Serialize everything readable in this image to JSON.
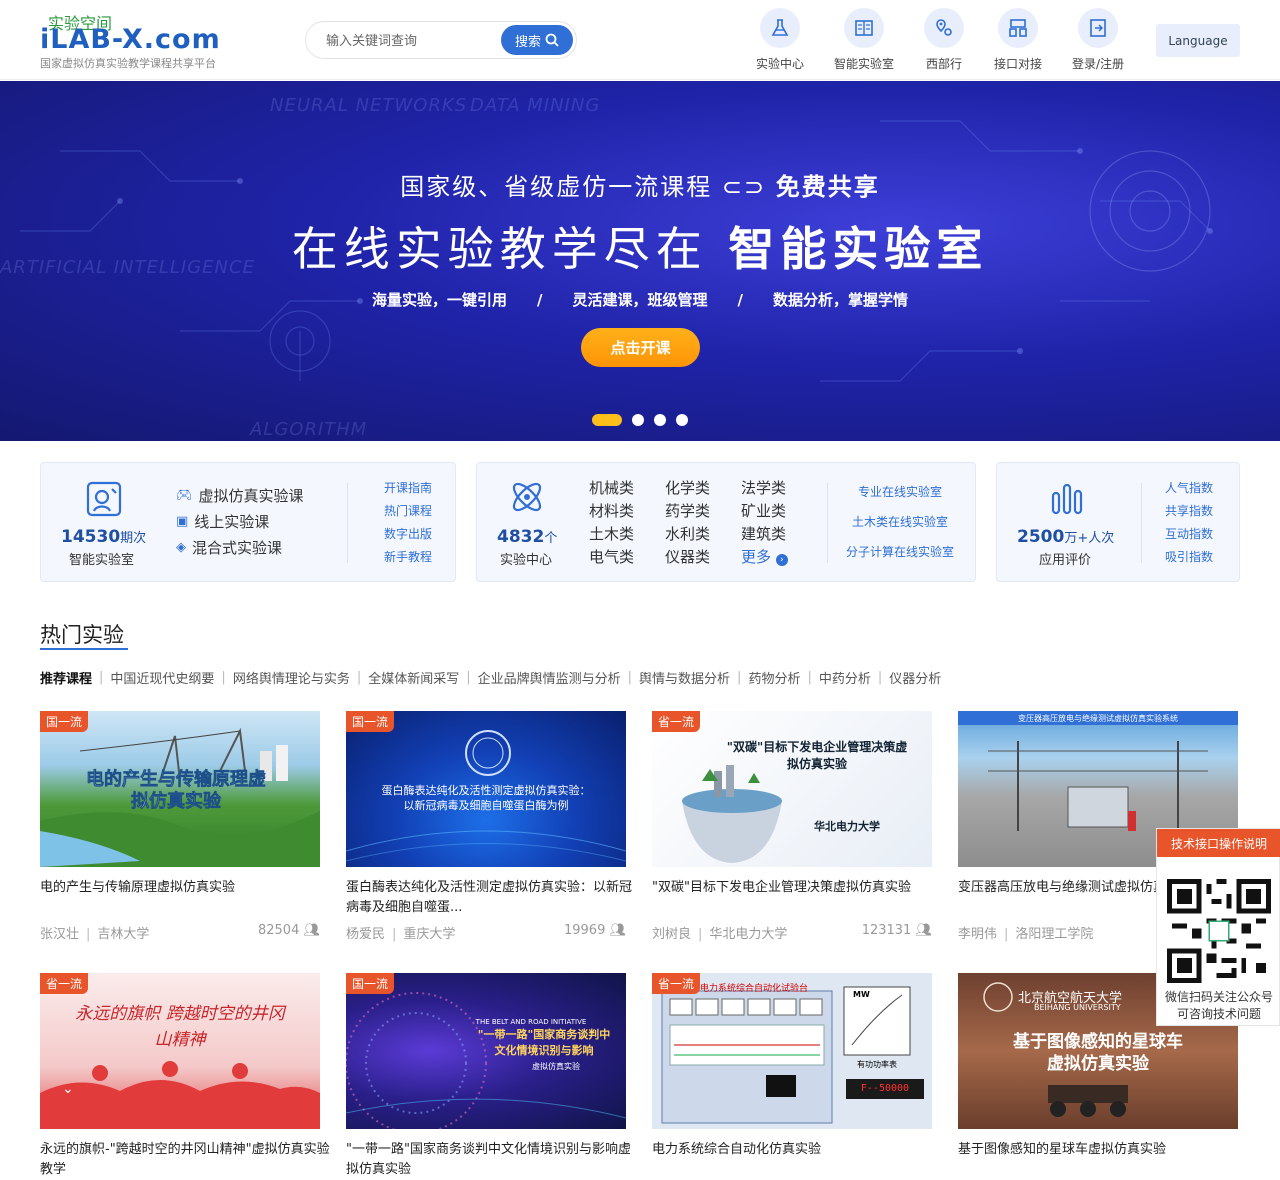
{
  "header": {
    "logo_cn": "实验空间",
    "logo_en": "iLAB-X.com",
    "logo_sub": "国家虚拟仿真实验教学课程共享平台",
    "search_placeholder": "输入关键词查询",
    "search_btn": "搜索",
    "nav": [
      "实验中心",
      "智能实验室",
      "西部行",
      "接口对接",
      "登录/注册"
    ],
    "language": "Language"
  },
  "banner": {
    "line1_a": "国家级、省级虚仿一流课程",
    "line1_b": "免费共享",
    "line2_a": "在线实验教学尽在",
    "line2_b": "智能实验室",
    "line3": "海量实验，一键引用　　/　　灵活建课，班级管理　　/　　数据分析，掌握学情",
    "btn": "点击开课",
    "slide_count": 4,
    "active_slide": 1
  },
  "stats": {
    "lab": {
      "num": "14530",
      "unit": "期次",
      "label": "智能实验室",
      "types": [
        "虚拟仿真实验课",
        "线上实验课",
        "混合式实验课"
      ],
      "links": [
        "开课指南",
        "热门课程",
        "数字出版",
        "新手教程"
      ]
    },
    "center": {
      "num": "4832",
      "unit": "个",
      "label": "实验中心",
      "cats": [
        "机械类",
        "化学类",
        "法学类",
        "材料类",
        "药学类",
        "矿业类",
        "土木类",
        "水利类",
        "建筑类",
        "电气类",
        "仪器类"
      ],
      "more": "更多",
      "links": [
        "专业在线实验室",
        "土木类在线实验室",
        "分子计算在线实验室"
      ]
    },
    "eval": {
      "num": "2500",
      "unit": "万+人次",
      "label": "应用评价",
      "links": [
        "人气指数",
        "共享指数",
        "互动指数",
        "吸引指数"
      ]
    }
  },
  "hot": {
    "title": "热门实验",
    "tabs": [
      "推荐课程",
      "中国近现代史纲要",
      "网络舆情理论与实务",
      "全媒体新闻采写",
      "企业品牌舆情监测与分析",
      "舆情与数据分析",
      "药物分析",
      "中药分析",
      "仪器分析"
    ],
    "cards": [
      {
        "badge": "国一流",
        "title": "电的产生与传输原理虚拟仿真实验",
        "teacher": "张汉壮",
        "school": "吉林大学",
        "views": "82504",
        "thumb_text": "电的产生与传输原理虚拟仿真实验"
      },
      {
        "badge": "国一流",
        "title": "蛋白酶表达纯化及活性测定虚拟仿真实验：以新冠病毒及细胞自噬蛋...",
        "teacher": "杨爱民",
        "school": "重庆大学",
        "views": "19969",
        "thumb_text": "蛋白酶表达纯化及活性测定虚拟仿真实验：以新冠病毒及细胞自噬蛋白酶为例"
      },
      {
        "badge": "省一流",
        "title": "\"双碳\"目标下发电企业管理决策虚拟仿真实验",
        "teacher": "刘树良",
        "school": "华北电力大学",
        "views": "123131",
        "thumb_text": "\"双碳\"目标下发电企业管理决策虚拟仿真实验",
        "thumb_school": "华北电力大学"
      },
      {
        "badge": "",
        "title": "变压器高压放电与绝缘测试虚拟仿真实验",
        "teacher": "李明伟",
        "school": "洛阳理工学院",
        "views": "",
        "thumb_text": "变压器高压放电与绝缘测试虚拟仿真实验系统"
      },
      {
        "badge": "省一流",
        "title": "永远的旗帜-\"跨越时空的井冈山精神\"虚拟仿真实验教学",
        "teacher": "",
        "school": "",
        "views": "",
        "thumb_text": "永远的旗帜 跨越时空的井冈山精神"
      },
      {
        "badge": "国一流",
        "title": "\"一带一路\"国家商务谈判中文化情境识别与影响虚拟仿真实验",
        "teacher": "",
        "school": "",
        "views": "",
        "thumb_text": "\"一带一路\"国家商务谈判中文化情境识别与影响",
        "thumb_en": "THE BELT AND ROAD INITIATIVE",
        "thumb_sub": "虚拟仿真实验"
      },
      {
        "badge": "省一流",
        "title": "电力系统综合自动化仿真实验",
        "teacher": "",
        "school": "",
        "views": "",
        "thumb_text": "电力系统综合自动化试验台",
        "thumb_mw": "MW",
        "thumb_power": "有功功率表",
        "thumb_num": "F--50000"
      },
      {
        "badge": "",
        "title": "基于图像感知的星球车虚拟仿真实验",
        "teacher": "",
        "school": "",
        "views": "",
        "thumb_text": "基于图像感知的星球车虚拟仿真实验",
        "thumb_school": "北京航空航天大学",
        "thumb_en": "BEIHANG UNIVERSITY"
      }
    ]
  },
  "float": {
    "head": "技术接口操作说明",
    "text": "微信扫码关注公众号可咨询技术问题"
  },
  "colors": {
    "primary": "#2f6fd6",
    "accent": "#ff9f0f",
    "badge": "#e8552a"
  }
}
